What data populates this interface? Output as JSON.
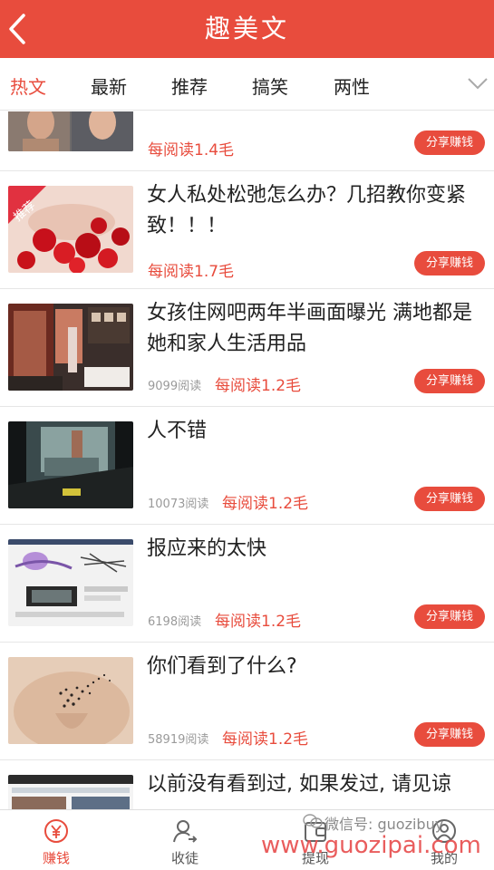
{
  "header": {
    "title": "趣美文"
  },
  "tabs": [
    {
      "label": "热文"
    },
    {
      "label": "最新"
    },
    {
      "label": "推荐"
    },
    {
      "label": "搞笑"
    },
    {
      "label": "两性"
    }
  ],
  "feed": {
    "items": [
      {
        "title": "",
        "reads": "",
        "rate": "每阅读1.4毛",
        "share": "分享赚钱",
        "badge": ""
      },
      {
        "title": "女人私处松弛怎么办？几招教你变紧致！！！",
        "reads": "",
        "rate": "每阅读1.7毛",
        "share": "分享赚钱",
        "badge": "推荐"
      },
      {
        "title": "女孩住网吧两年半画面曝光 满地都是她和家人生活用品",
        "reads": "9099阅读",
        "rate": "每阅读1.2毛",
        "share": "分享赚钱",
        "badge": ""
      },
      {
        "title": "人不错",
        "reads": "10073阅读",
        "rate": "每阅读1.2毛",
        "share": "分享赚钱",
        "badge": ""
      },
      {
        "title": "报应来的太快",
        "reads": "6198阅读",
        "rate": "每阅读1.2毛",
        "share": "分享赚钱",
        "badge": ""
      },
      {
        "title": "你们看到了什么?",
        "reads": "58919阅读",
        "rate": "每阅读1.2毛",
        "share": "分享赚钱",
        "badge": ""
      },
      {
        "title": "以前没有看到过, 如果发过, 请见谅",
        "reads": "",
        "rate": "",
        "share": "",
        "badge": ""
      }
    ]
  },
  "bottom_nav": [
    {
      "label": "赚钱",
      "icon": "yen-circle-icon",
      "active": true
    },
    {
      "label": "收徒",
      "icon": "add-user-icon"
    },
    {
      "label": "提现",
      "icon": "wallet-icon"
    },
    {
      "label": "我的",
      "icon": "profile-icon"
    }
  ],
  "watermark": {
    "wechat": "微信号: guozibuy",
    "url": "www.guozipai.com"
  },
  "colors": {
    "accent": "#e84c3d",
    "divider": "#e6e6e6",
    "muted": "#9a9a9a"
  }
}
